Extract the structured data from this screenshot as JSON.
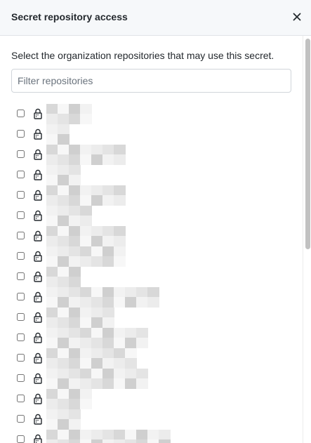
{
  "dialog": {
    "title": "Secret repository access",
    "description": "Select the organization repositories that may use this secret.",
    "filter": {
      "placeholder": "Filter repositories",
      "value": ""
    }
  },
  "icons": {
    "close": "close-icon",
    "lock": "lock-icon"
  },
  "colors": {
    "header_bg": "#f6f8fa",
    "border": "#e1e4e8",
    "text": "#24292e",
    "placeholder": "#6a737d"
  },
  "repositories": [
    {
      "name": "",
      "checked": false,
      "private": true
    },
    {
      "name": "",
      "checked": false,
      "private": true
    },
    {
      "name": "",
      "checked": false,
      "private": true
    },
    {
      "name": "",
      "checked": false,
      "private": true
    },
    {
      "name": "",
      "checked": false,
      "private": true
    },
    {
      "name": "",
      "checked": false,
      "private": true
    },
    {
      "name": "",
      "checked": false,
      "private": true
    },
    {
      "name": "",
      "checked": false,
      "private": true
    },
    {
      "name": "",
      "checked": false,
      "private": true
    },
    {
      "name": "",
      "checked": false,
      "private": true
    },
    {
      "name": "",
      "checked": false,
      "private": true
    },
    {
      "name": "",
      "checked": false,
      "private": true
    },
    {
      "name": "",
      "checked": false,
      "private": true
    },
    {
      "name": "",
      "checked": false,
      "private": true
    },
    {
      "name": "",
      "checked": false,
      "private": true
    },
    {
      "name": "",
      "checked": false,
      "private": true
    },
    {
      "name": "",
      "checked": false,
      "private": true
    }
  ]
}
